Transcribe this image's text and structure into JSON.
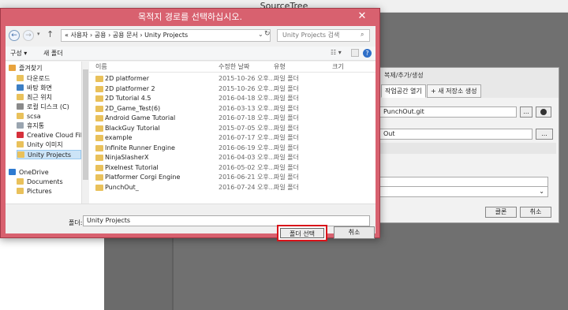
{
  "app": {
    "title": "SourceTree"
  },
  "clone_dialog": {
    "tab_clone_title": "복제/추가/생성",
    "tabs": [
      "작업공간 열기",
      "+ 새 저장소 생성"
    ],
    "source_url": "PunchOut.git",
    "dest_path": "Out",
    "browse_label": "...",
    "clone_button": "클론",
    "cancel_button": "취소"
  },
  "dialog": {
    "title": "목적지 경로를 선택하십시오.",
    "close_glyph": "✕",
    "address": "« 사용자 › 공용 › 공용 문서 › Unity Projects",
    "search_placeholder": "Unity Projects 검색",
    "toolbar": {
      "organize": "구성 ▾",
      "new_folder": "새 폴더"
    },
    "nav_items": [
      {
        "label": "즐겨찾기",
        "icon": "star-icon",
        "color": "#e8a33d"
      },
      {
        "label": "다운로드",
        "icon": "folder-icon",
        "color": "#e9c15b"
      },
      {
        "label": "바탕 화면",
        "icon": "desktop-icon",
        "color": "#3d7fc4"
      },
      {
        "label": "최근 위치",
        "icon": "recent-icon",
        "color": "#e9c15b"
      },
      {
        "label": "로컬 디스크 (C)",
        "icon": "drive-icon",
        "color": "#8a8a8a"
      },
      {
        "label": "scsa",
        "icon": "folder-icon",
        "color": "#e9c15b"
      },
      {
        "label": "휴지통",
        "icon": "trash-icon",
        "color": "#9aa5b0"
      },
      {
        "label": "Creative Cloud File",
        "icon": "creative-cloud-icon",
        "color": "#d6303b"
      },
      {
        "label": "Unity 이미지",
        "icon": "folder-icon",
        "color": "#e9c15b"
      },
      {
        "label": "Unity Projects",
        "icon": "folder-icon",
        "color": "#e9c15b"
      },
      {
        "label": "OneDrive",
        "icon": "onedrive-icon",
        "color": "#2f7bd0"
      },
      {
        "label": "Documents",
        "icon": "folder-icon",
        "color": "#e9c15b"
      },
      {
        "label": "Pictures",
        "icon": "folder-icon",
        "color": "#e9c15b"
      }
    ],
    "columns": {
      "name": "이름",
      "date": "수정한 날짜",
      "type": "유형",
      "size": "크기"
    },
    "files": [
      {
        "name": "2D platformer",
        "date": "2015-10-26 오후...",
        "type": "파일 폴더"
      },
      {
        "name": "2D platformer 2",
        "date": "2015-10-26 오후...",
        "type": "파일 폴더"
      },
      {
        "name": "2D Tutorial 4.5",
        "date": "2016-04-18 오후...",
        "type": "파일 폴더"
      },
      {
        "name": "2D_Game_Test(6)",
        "date": "2016-03-13 오후...",
        "type": "파일 폴더"
      },
      {
        "name": "Android Game Tutorial",
        "date": "2016-07-18 오후...",
        "type": "파일 폴더"
      },
      {
        "name": "BlackGuy Tutorial",
        "date": "2015-07-05 오후...",
        "type": "파일 폴더"
      },
      {
        "name": "example",
        "date": "2016-07-17 오후...",
        "type": "파일 폴더"
      },
      {
        "name": "Infinite Runner Engine",
        "date": "2016-06-19 오후...",
        "type": "파일 폴더"
      },
      {
        "name": "NinjaSlasherX",
        "date": "2016-04-03 오후...",
        "type": "파일 폴더"
      },
      {
        "name": "Pixelnest Tutorial",
        "date": "2016-05-02 오후...",
        "type": "파일 폴더"
      },
      {
        "name": "Platformer Corgi Engine",
        "date": "2016-06-21 오후...",
        "type": "파일 폴더"
      },
      {
        "name": "PunchOut_",
        "date": "2016-07-24 오후...",
        "type": "파일 폴더"
      }
    ],
    "folder_label": "폴더:",
    "folder_value": "Unity Projects",
    "select_button": "폴더 선택",
    "cancel_button": "취소"
  }
}
